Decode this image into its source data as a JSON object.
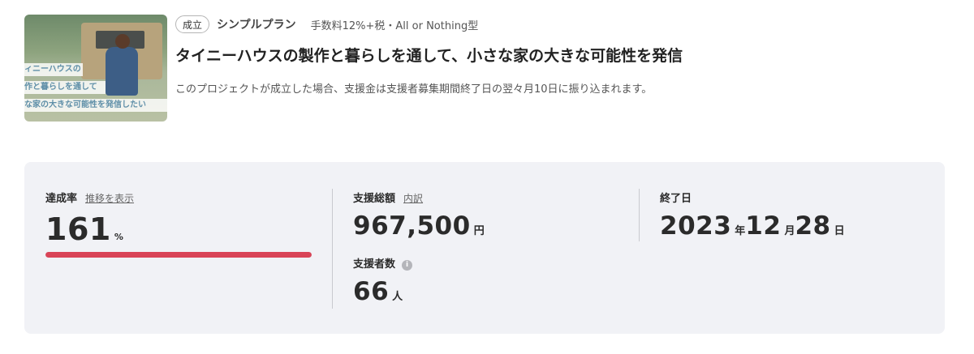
{
  "project": {
    "thumbnail": {
      "alt": "project-thumbnail",
      "overlay_lines": [
        "ィニーハウスの",
        "作と暮らしを通して",
        "な家の大きな可能性を発信したい"
      ]
    },
    "status_badge": "成立",
    "plan_name": "シンプルプラン",
    "fee_text": "手数料12%+税・All or Nothing型",
    "title": "タイニーハウスの製作と暮らしを通して、小さな家の大きな可能性を発信",
    "note": "このプロジェクトが成立した場合、支援金は支援者募集期間終了日の翌々月10日に振り込まれます。"
  },
  "stats": {
    "achievement": {
      "label": "達成率",
      "link": "推移を表示",
      "value": "161",
      "unit": "%",
      "progress": 1.0,
      "bar_color": "#d94457"
    },
    "total": {
      "label": "支援総額",
      "link": "内訳",
      "value": "967,500",
      "unit": "円"
    },
    "backers": {
      "label": "支援者数",
      "info_icon": "info-icon",
      "value": "66",
      "unit": "人"
    },
    "end_date": {
      "label": "終了日",
      "year": "2023",
      "year_unit": "年",
      "month": "12",
      "month_unit": "月",
      "day": "28",
      "day_unit": "日"
    }
  }
}
